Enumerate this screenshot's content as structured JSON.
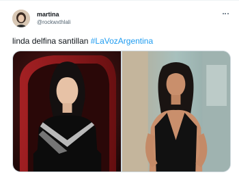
{
  "tweet": {
    "display_name": "martina",
    "handle": "@rockwxthlali",
    "text": "linda delfina santillan ",
    "hashtag": "#LaVozArgentina",
    "more_icon": "more-options-icon"
  },
  "media": {
    "photo_count": 2,
    "photos": [
      {
        "icon": "photo-woman-red-chair"
      },
      {
        "icon": "photo-woman-black-dress"
      }
    ]
  },
  "colors": {
    "hashtag": "#1d9bf0",
    "secondary_text": "#536471",
    "border": "#cfd9de"
  }
}
